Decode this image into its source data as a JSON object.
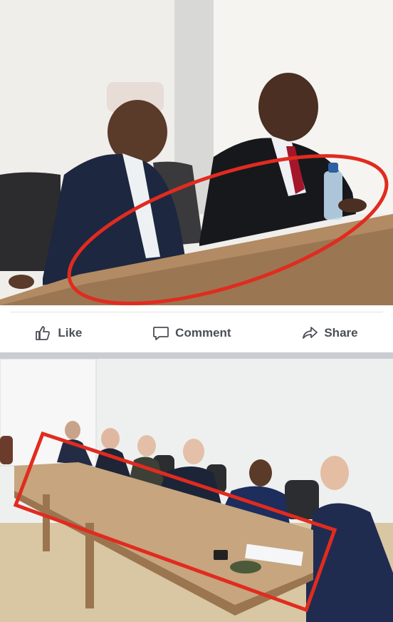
{
  "post": {
    "actions": [
      {
        "label": "Like",
        "icon": "thumbs-up-icon"
      },
      {
        "label": "Comment",
        "icon": "comment-bubble-icon"
      },
      {
        "label": "Share",
        "icon": "share-arrow-icon"
      }
    ]
  },
  "colors": {
    "highlight": "#e12b1f",
    "action_text": "#4b4f56",
    "separator": "#c9ccd1"
  }
}
